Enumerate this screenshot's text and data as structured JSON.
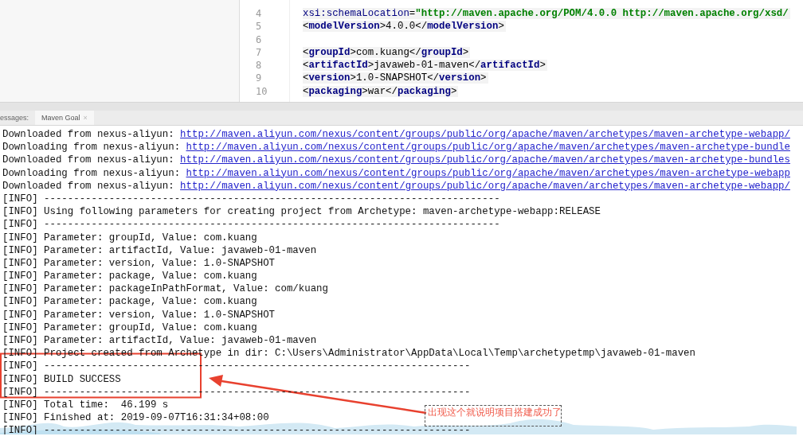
{
  "editor": {
    "lines": [
      {
        "number": "4",
        "segments": [
          {
            "kind": "attr",
            "text": "xsi:schemaLocation"
          },
          {
            "kind": "punct",
            "text": "="
          },
          {
            "kind": "value",
            "text": "\"http://maven.apache.org/POM/4.0.0 http://maven.apache.org/xsd/"
          }
        ]
      },
      {
        "number": "5",
        "segments": [
          {
            "kind": "punct",
            "text": "<"
          },
          {
            "kind": "tag",
            "text": "modelVersion"
          },
          {
            "kind": "punct",
            "text": ">"
          },
          {
            "kind": "text",
            "text": "4.0.0"
          },
          {
            "kind": "punct",
            "text": "</"
          },
          {
            "kind": "tag",
            "text": "modelVersion"
          },
          {
            "kind": "punct",
            "text": ">"
          }
        ]
      },
      {
        "number": "6"
      },
      {
        "number": "7",
        "segments": [
          {
            "kind": "punct",
            "text": "<"
          },
          {
            "kind": "tag",
            "text": "groupId"
          },
          {
            "kind": "punct",
            "text": ">"
          },
          {
            "kind": "text",
            "text": "com.kuang"
          },
          {
            "kind": "punct",
            "text": "</"
          },
          {
            "kind": "tag",
            "text": "groupId"
          },
          {
            "kind": "punct",
            "text": ">"
          }
        ]
      },
      {
        "number": "8",
        "segments": [
          {
            "kind": "punct",
            "text": "<"
          },
          {
            "kind": "tag",
            "text": "artifactId"
          },
          {
            "kind": "punct",
            "text": ">"
          },
          {
            "kind": "text",
            "text": "javaweb-01-maven"
          },
          {
            "kind": "punct",
            "text": "</"
          },
          {
            "kind": "tag",
            "text": "artifactId"
          },
          {
            "kind": "punct",
            "text": ">"
          }
        ]
      },
      {
        "number": "9",
        "segments": [
          {
            "kind": "punct",
            "text": "<"
          },
          {
            "kind": "tag",
            "text": "version"
          },
          {
            "kind": "punct",
            "text": ">"
          },
          {
            "kind": "text",
            "text": "1.0-SNAPSHOT"
          },
          {
            "kind": "punct",
            "text": "</"
          },
          {
            "kind": "tag",
            "text": "version"
          },
          {
            "kind": "punct",
            "text": ">"
          }
        ]
      },
      {
        "number": "10",
        "segments": [
          {
            "kind": "punct",
            "text": "<"
          },
          {
            "kind": "tag",
            "text": "packaging"
          },
          {
            "kind": "punct",
            "text": ">"
          },
          {
            "kind": "text",
            "text": "war"
          },
          {
            "kind": "punct",
            "text": "</"
          },
          {
            "kind": "tag",
            "text": "packaging"
          },
          {
            "kind": "punct",
            "text": ">"
          }
        ]
      }
    ]
  },
  "console": {
    "label": "essages:",
    "tabs": [
      {
        "label": "Maven Goal",
        "close": "×",
        "selected": true
      }
    ],
    "lines": [
      {
        "kind": "download",
        "text": "Downloaded from nexus-aliyun:",
        "url": "http://maven.aliyun.com/nexus/content/groups/public/org/apache/maven/archetypes/maven-archetype-webapp/"
      },
      {
        "kind": "download",
        "text": "Downloading from nexus-aliyun:",
        "url": "http://maven.aliyun.com/nexus/content/groups/public/org/apache/maven/archetypes/maven-archetype-bundle"
      },
      {
        "kind": "download",
        "text": "Downloaded from nexus-aliyun:",
        "url": "http://maven.aliyun.com/nexus/content/groups/public/org/apache/maven/archetypes/maven-archetype-bundles"
      },
      {
        "kind": "download",
        "text": "Downloading from nexus-aliyun:",
        "url": "http://maven.aliyun.com/nexus/content/groups/public/org/apache/maven/archetypes/maven-archetype-webapp"
      },
      {
        "kind": "download",
        "text": "Downloaded from nexus-aliyun:",
        "url": "http://maven.aliyun.com/nexus/content/groups/public/org/apache/maven/archetypes/maven-archetype-webapp/"
      },
      {
        "kind": "info",
        "text": "[INFO] -----------------------------------------------------------------------------"
      },
      {
        "kind": "info",
        "text": "[INFO] Using following parameters for creating project from Archetype: maven-archetype-webapp:RELEASE"
      },
      {
        "kind": "info",
        "text": "[INFO] -----------------------------------------------------------------------------"
      },
      {
        "kind": "info",
        "text": "[INFO] Parameter: groupId, Value: com.kuang"
      },
      {
        "kind": "info",
        "text": "[INFO] Parameter: artifactId, Value: javaweb-01-maven"
      },
      {
        "kind": "info",
        "text": "[INFO] Parameter: version, Value: 1.0-SNAPSHOT"
      },
      {
        "kind": "info",
        "text": "[INFO] Parameter: package, Value: com.kuang"
      },
      {
        "kind": "info",
        "text": "[INFO] Parameter: packageInPathFormat, Value: com/kuang"
      },
      {
        "kind": "info",
        "text": "[INFO] Parameter: package, Value: com.kuang"
      },
      {
        "kind": "info",
        "text": "[INFO] Parameter: version, Value: 1.0-SNAPSHOT"
      },
      {
        "kind": "info",
        "text": "[INFO] Parameter: groupId, Value: com.kuang"
      },
      {
        "kind": "info",
        "text": "[INFO] Parameter: artifactId, Value: javaweb-01-maven"
      },
      {
        "kind": "info",
        "text": "[INFO] Project created from Archetype in dir: C:\\Users\\Administrator\\AppData\\Local\\Temp\\archetypetmp\\javaweb-01-maven"
      },
      {
        "kind": "info",
        "text": "[INFO] ------------------------------------------------------------------------"
      },
      {
        "kind": "info",
        "text": "[INFO] BUILD SUCCESS"
      },
      {
        "kind": "info",
        "text": "[INFO] ------------------------------------------------------------------------"
      },
      {
        "kind": "info",
        "text": "[INFO] Total time:  46.199 s"
      },
      {
        "kind": "info",
        "text": "[INFO] Finished at: 2019-09-07T16:31:34+08:00"
      },
      {
        "kind": "info",
        "text": "[INFO] ------------------------------------------------------------------------"
      }
    ]
  },
  "annotation": {
    "note": "出现这个就说明项目搭建成功了"
  }
}
